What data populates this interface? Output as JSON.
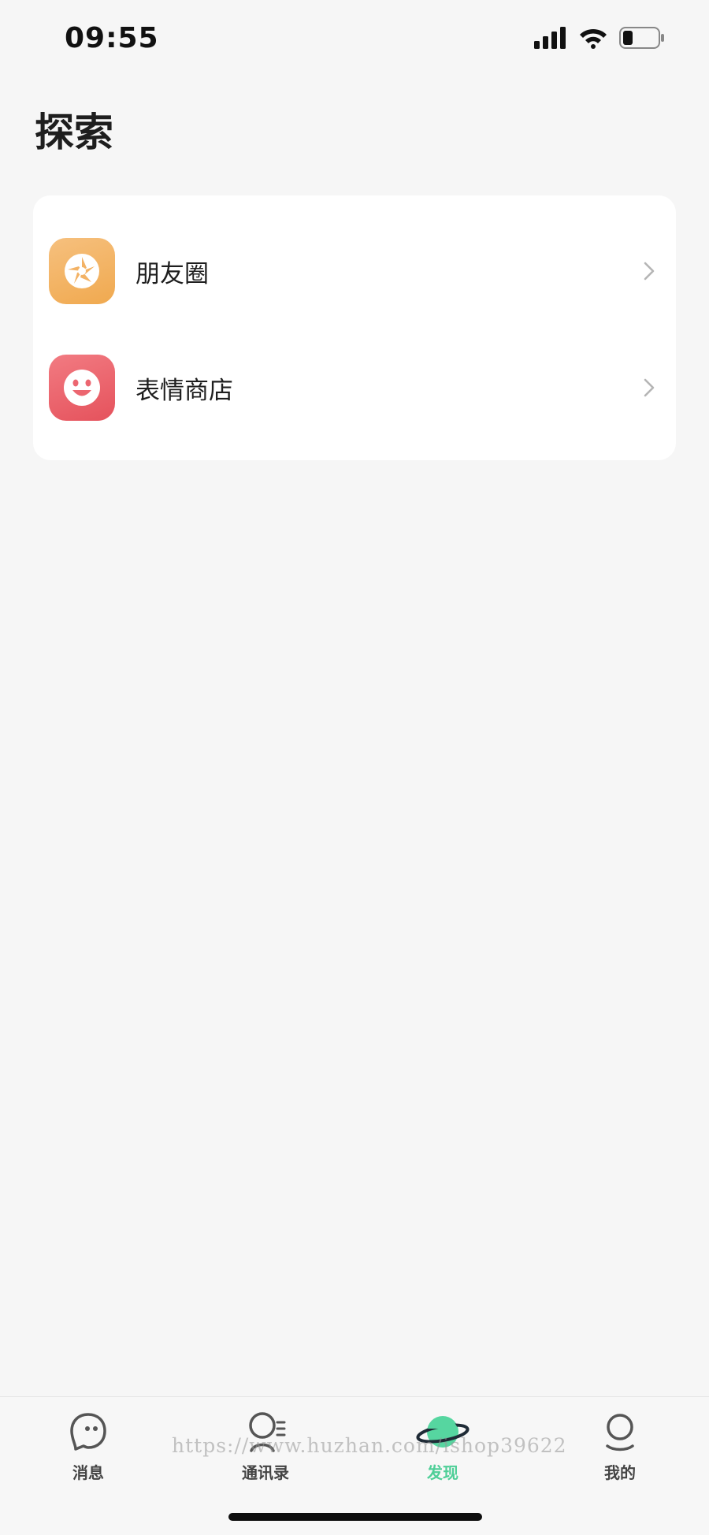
{
  "status_bar": {
    "time": "09:55",
    "icons": [
      "signal-icon",
      "wifi-icon",
      "battery-icon"
    ]
  },
  "page": {
    "title": "探索"
  },
  "menu": {
    "items": [
      {
        "label": "朋友圈",
        "icon": "camera-aperture-icon",
        "color": "#f3b265"
      },
      {
        "label": "表情商店",
        "icon": "smiley-face-icon",
        "color": "#ec6670"
      }
    ]
  },
  "tab_bar": {
    "active_index": 2,
    "active_color": "#4fcf98",
    "tabs": [
      {
        "label": "消息",
        "icon": "chat-bubble-icon"
      },
      {
        "label": "通讯录",
        "icon": "contacts-icon"
      },
      {
        "label": "发现",
        "icon": "planet-icon"
      },
      {
        "label": "我的",
        "icon": "profile-icon"
      }
    ]
  },
  "watermark": "https://www.huzhan.com/ishop39622"
}
